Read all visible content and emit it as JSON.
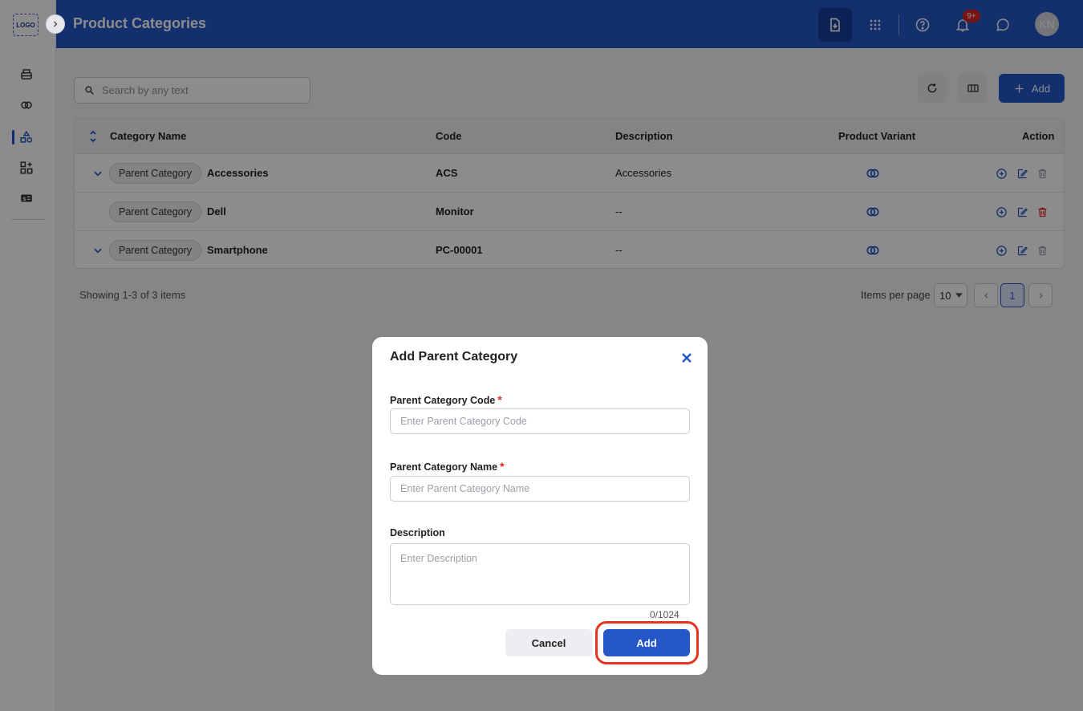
{
  "app": {
    "logo_text": "LOGO"
  },
  "header": {
    "title": "Product Categories",
    "notification_badge": "9+",
    "avatar_initials": "KN"
  },
  "sidebar": {
    "items": [
      {
        "icon": "printer-icon"
      },
      {
        "icon": "variant-icon"
      },
      {
        "icon": "category-icon",
        "active": true
      },
      {
        "icon": "apps-add-icon"
      },
      {
        "icon": "price-tag-icon"
      }
    ]
  },
  "toolbar": {
    "search_placeholder": "Search by any text",
    "add_label": "Add"
  },
  "table": {
    "columns": [
      "Category Name",
      "Code",
      "Description",
      "Product Variant",
      "Action"
    ],
    "rows": [
      {
        "expandable": true,
        "tag": "Parent Category",
        "name": "Accessories",
        "code": "ACS",
        "description": "Accessories"
      },
      {
        "expandable": false,
        "tag": "Parent Category",
        "name": "Dell",
        "code": "Monitor",
        "description": "--"
      },
      {
        "expandable": true,
        "tag": "Parent Category",
        "name": "Smartphone",
        "code": "PC-00001",
        "description": "--"
      }
    ]
  },
  "pagination": {
    "summary": "Showing 1-3 of 3 items",
    "items_per_page_label": "Items per page",
    "items_per_page": "10",
    "current_page": "1"
  },
  "modal": {
    "title": "Add Parent Category",
    "code_label": "Parent Category Code",
    "code_placeholder": "Enter Parent Category Code",
    "name_label": "Parent Category Name",
    "name_placeholder": "Enter Parent Category Name",
    "description_label": "Description",
    "description_placeholder": "Enter Description",
    "counter": "0/1024",
    "cancel_label": "Cancel",
    "submit_label": "Add",
    "required_mark": "*"
  },
  "colors": {
    "brand": "#2557c9",
    "danger": "#dc2626",
    "highlight": "#e5341f"
  }
}
